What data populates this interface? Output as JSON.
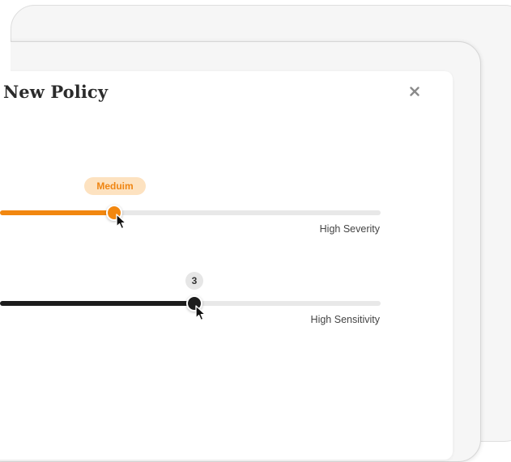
{
  "modal": {
    "title": "New Policy",
    "close_icon": "close-icon"
  },
  "severity_slider": {
    "value_label": "Meduim",
    "max_label": "High Severity",
    "fill_fraction": 0.3,
    "accent_color": "#f2870f"
  },
  "sensitivity_slider": {
    "value_label": "3",
    "max_label": "High Sensitivity",
    "fill_fraction": 0.51,
    "accent_color": "#1c1c1c"
  },
  "icons": [
    "close-icon",
    "pointer-cursor-icon"
  ]
}
